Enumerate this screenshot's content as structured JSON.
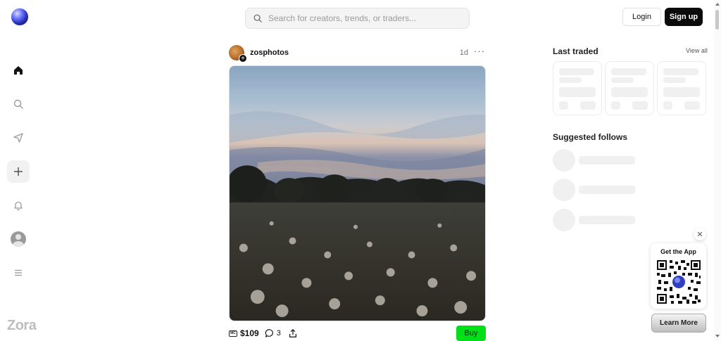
{
  "brand": {
    "name": "Zora"
  },
  "search": {
    "placeholder": "Search for creators, trends, or traders..."
  },
  "header": {
    "login_label": "Login",
    "signup_label": "Sign up"
  },
  "nav": {
    "items": [
      "home-icon",
      "search-icon",
      "send-icon",
      "plus-icon",
      "bell-icon",
      "profile-icon",
      "menu-icon"
    ],
    "active": "home-icon"
  },
  "post": {
    "username": "zosphotos",
    "time_ago": "1d",
    "more": "···",
    "market_cap_icon": "MC",
    "price": "$109",
    "comment_count": "3",
    "buy_label": "Buy"
  },
  "sidebar": {
    "last_traded_title": "Last traded",
    "view_all_label": "View all",
    "suggested_title": "Suggested follows"
  },
  "app_promo": {
    "title": "Get the App",
    "learn_more_label": "Learn More",
    "close": "✕"
  },
  "colors": {
    "buy": "#00e019",
    "signup": "#0b0b0b",
    "skeleton": "#f0f0f0"
  }
}
